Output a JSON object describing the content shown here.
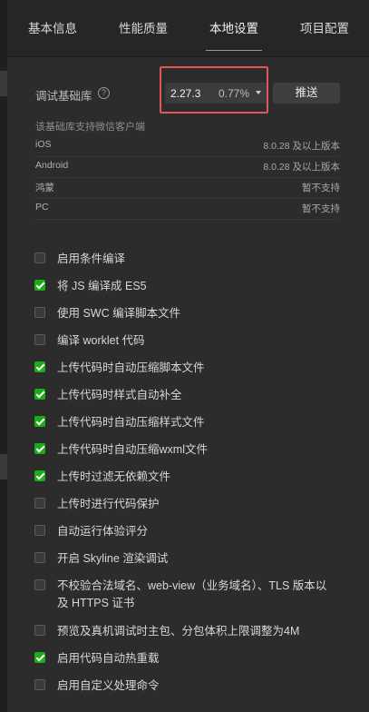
{
  "tabs": [
    {
      "label": "基本信息"
    },
    {
      "label": "性能质量"
    },
    {
      "label": "本地设置",
      "active": true
    },
    {
      "label": "项目配置"
    }
  ],
  "base_library": {
    "label": "调试基础库",
    "help_icon": "question-circle-icon",
    "version": "2.27.3",
    "percent": "0.77%",
    "push_label": "推送",
    "support_title": "该基础库支持微信客户端",
    "clients": [
      {
        "name": "iOS",
        "requirement": "8.0.28 及以上版本"
      },
      {
        "name": "Android",
        "requirement": "8.0.28 及以上版本"
      },
      {
        "name": "鸿蒙",
        "requirement": "暂不支持"
      },
      {
        "name": "PC",
        "requirement": "暂不支持"
      }
    ]
  },
  "options": [
    {
      "label": "启用条件编译",
      "checked": false
    },
    {
      "label": "将 JS 编译成 ES5",
      "checked": true
    },
    {
      "label": "使用 SWC 编译脚本文件",
      "checked": false
    },
    {
      "label": "编译 worklet 代码",
      "checked": false
    },
    {
      "label": "上传代码时自动压缩脚本文件",
      "checked": true
    },
    {
      "label": "上传代码时样式自动补全",
      "checked": true
    },
    {
      "label": "上传代码时自动压缩样式文件",
      "checked": true
    },
    {
      "label": "上传代码时自动压缩wxml文件",
      "checked": true
    },
    {
      "label": "上传时过滤无依赖文件",
      "checked": true
    },
    {
      "label": "上传时进行代码保护",
      "checked": false
    },
    {
      "label": "自动运行体验评分",
      "checked": false
    },
    {
      "label": "开启 Skyline 渲染调试",
      "checked": false
    },
    {
      "label": "不校验合法域名、web-view（业务域名）、TLS 版本以及 HTTPS 证书",
      "checked": false
    },
    {
      "label": "预览及真机调试时主包、分包体积上限调整为4M",
      "checked": false
    },
    {
      "label": "启用代码自动热重载",
      "checked": true
    },
    {
      "label": "启用自定义处理命令",
      "checked": false
    }
  ],
  "colors": {
    "background": "#2c2c2c",
    "checkbox_checked": "#1aad19",
    "highlight": "#e05757"
  }
}
